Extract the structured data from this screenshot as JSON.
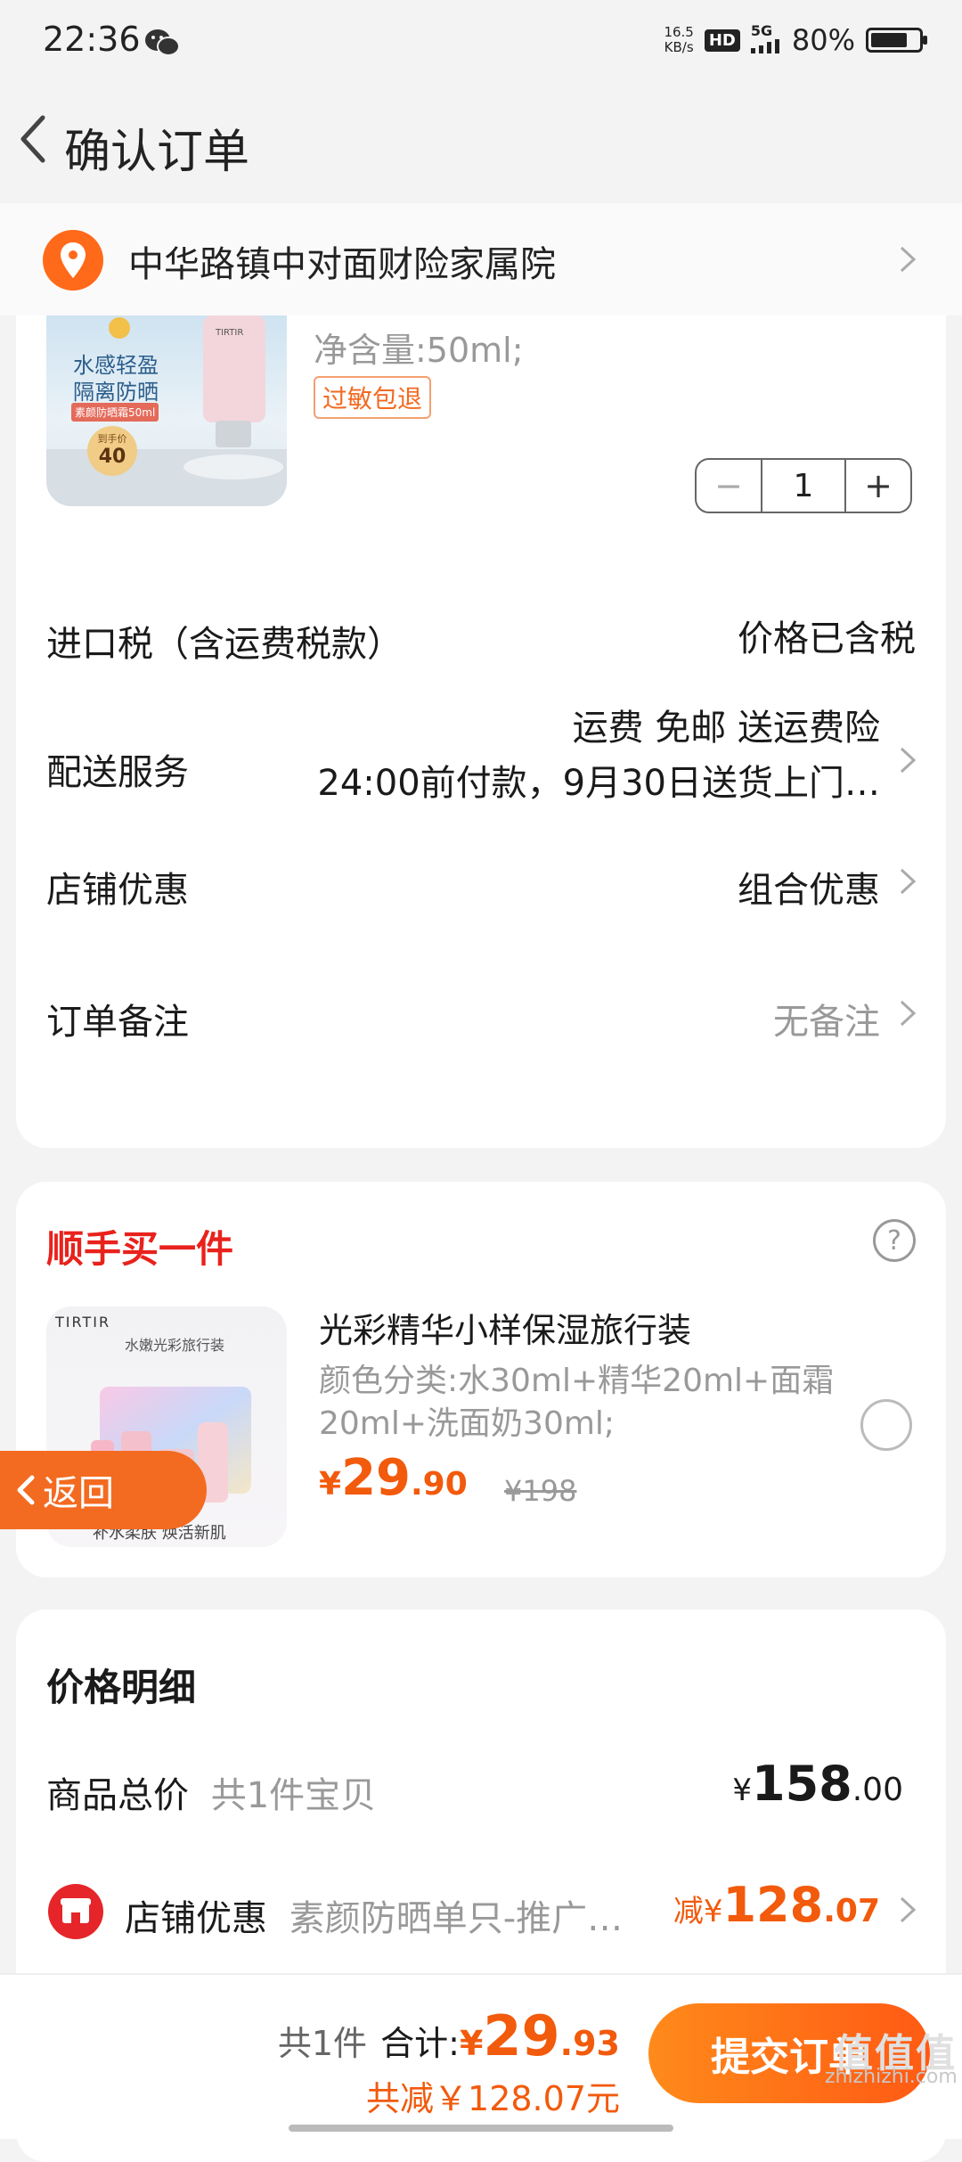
{
  "status_bar": {
    "time": "22:36",
    "net_speed_value": "16.5",
    "net_speed_unit": "KB/s",
    "hd_badge": "HD",
    "network": "5G",
    "battery": "80%",
    "battery_level": 0.8,
    "icons": [
      "wechat-icon",
      "signal-icon",
      "battery-icon"
    ]
  },
  "nav": {
    "title": "确认订单",
    "back_icon": "chevron-left-icon"
  },
  "address": {
    "text": "中华路镇中对面财险家属院",
    "icon": "location-pin-icon"
  },
  "product": {
    "image_texts": [
      "水感轻盈",
      "隔离防晒",
      "素颜防晒霜50ml",
      "到手价",
      "40",
      "TIRTIR"
    ],
    "spec": "净含量:50ml;",
    "tag": "过敏包退",
    "quantity": "1",
    "minus": "−",
    "plus": "+"
  },
  "rows": {
    "import_tax": {
      "label": "进口税（含运费税款）",
      "value": "价格已含税"
    },
    "delivery": {
      "label": "配送服务",
      "line1": "运费 免邮 送运费险",
      "line2": "24:00前付款，9月30日送货上门…"
    },
    "shop_discount": {
      "label": "店铺优惠",
      "value": "组合优惠"
    },
    "remark": {
      "label": "订单备注",
      "value": "无备注"
    }
  },
  "addon": {
    "title": "顺手买一件",
    "help": "?",
    "image_texts": [
      "TIRTIR",
      "水嫩光彩旅行装",
      "补水柔肤 焕活新肌"
    ],
    "name": "光彩精华小样保湿旅行装",
    "spec": "颜色分类:水30ml+精华20ml+面霜20ml+洗面奶30ml;",
    "price_symbol": "¥",
    "price_int": "29",
    "price_dec": ".90",
    "price_old": "¥198",
    "selected": false
  },
  "price_detail": {
    "title": "价格明细",
    "total": {
      "label": "商品总价",
      "sub": "共1件宝贝",
      "symbol": "¥",
      "int": "158",
      "dec": ".00"
    },
    "shop": {
      "label": "店铺优惠",
      "sub": "素颜防晒单只-推广…",
      "prefix": "减",
      "symbol": "¥",
      "int": "128",
      "dec": ".07"
    }
  },
  "float_back": {
    "label": "返回"
  },
  "bottom": {
    "count": "共1件",
    "total_label": "合计:",
    "symbol": "¥",
    "total_int": "29",
    "total_dec": ".93",
    "saved": "共减￥128.07元",
    "submit": "提交订单"
  },
  "watermark": {
    "site": "zhizhizhi.com",
    "logo": "值值值"
  },
  "colors": {
    "accent": "#f25a0c",
    "red": "#e8221c",
    "submit": "#ff6a14"
  }
}
